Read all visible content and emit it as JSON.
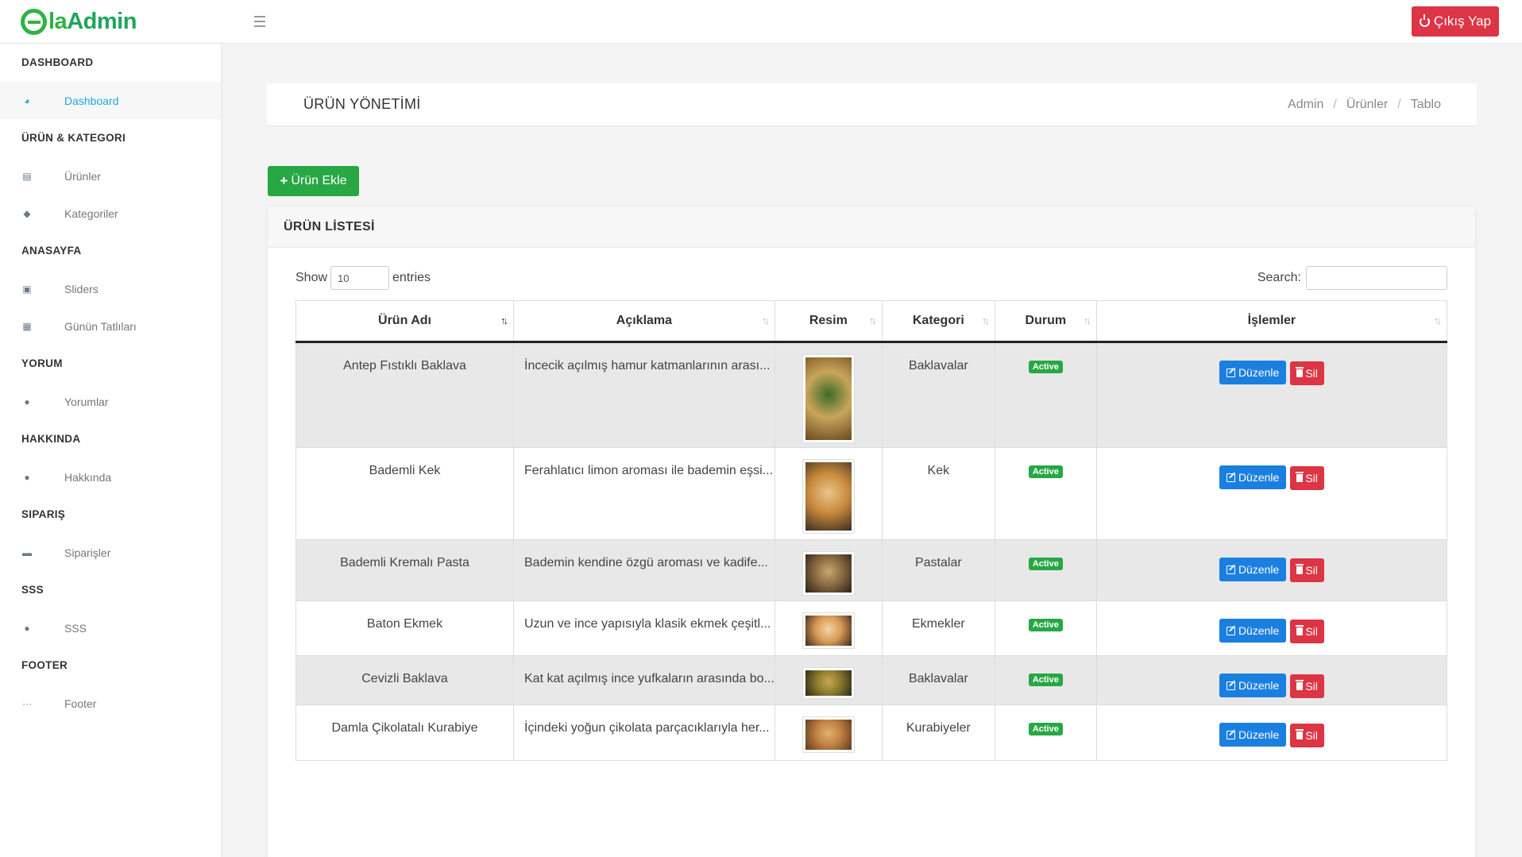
{
  "brand": {
    "logo_first": "la",
    "logo_second": "Admin"
  },
  "header": {
    "logout_label": "Çıkış Yap"
  },
  "sidebar": {
    "sections": [
      {
        "title": "DASHBOARD",
        "items": [
          {
            "label": "Dashboard",
            "icon": "dashboard-icon",
            "active": true
          }
        ]
      },
      {
        "title": "ÜRÜN & KATEGORI",
        "items": [
          {
            "label": "Ürünler",
            "icon": "basket-icon"
          },
          {
            "label": "Kategoriler",
            "icon": "tags-icon"
          }
        ]
      },
      {
        "title": "ANASAYFA",
        "items": [
          {
            "label": "Sliders",
            "icon": "image-icon"
          },
          {
            "label": "Günün Tatlıları",
            "icon": "gift-icon"
          }
        ]
      },
      {
        "title": "YORUM",
        "items": [
          {
            "label": "Yorumlar",
            "icon": "comments-icon"
          }
        ]
      },
      {
        "title": "HAKKINDA",
        "items": [
          {
            "label": "Hakkında",
            "icon": "info-icon"
          }
        ]
      },
      {
        "title": "SIPARIŞ",
        "items": [
          {
            "label": "Siparişler",
            "icon": "cart-icon"
          }
        ]
      },
      {
        "title": "SSS",
        "items": [
          {
            "label": "SSS",
            "icon": "question-icon"
          }
        ]
      },
      {
        "title": "FOOTER",
        "items": [
          {
            "label": "Footer",
            "icon": "ellipsis-icon"
          }
        ]
      }
    ]
  },
  "page": {
    "title": "ÜRÜN YÖNETİMİ",
    "breadcrumb": [
      "Admin",
      "Ürünler",
      "Tablo"
    ],
    "add_button": "Ürün Ekle"
  },
  "card": {
    "title": "ÜRÜN LİSTESİ",
    "show_label": "Show",
    "entries_value": "10",
    "entries_label": "entries",
    "search_label": "Search:"
  },
  "table": {
    "headers": [
      "Ürün Adı",
      "Açıklama",
      "Resim",
      "Kategori",
      "Durum",
      "İşlemler"
    ],
    "edit_label": "Düzenle",
    "delete_label": "Sil",
    "rows": [
      {
        "name": "Antep Fıstıklı Baklava",
        "desc": "İncecik açılmış hamur katmanlarının arası...",
        "category": "Baklavalar",
        "status": "Active",
        "img": "baklava-pistachio"
      },
      {
        "name": "Bademli Kek",
        "desc": "Ferahlatıcı limon aroması ile bademin eşsi...",
        "category": "Kek",
        "status": "Active",
        "img": "almond-cake"
      },
      {
        "name": "Bademli Kremalı Pasta",
        "desc": "Bademin kendine özgü aroması ve kadife...",
        "category": "Pastalar",
        "status": "Active",
        "img": "almond-cream-cake"
      },
      {
        "name": "Baton Ekmek",
        "desc": "Uzun ve ince yapısıyla klasik ekmek çeşitl...",
        "category": "Ekmekler",
        "status": "Active",
        "img": "baguette"
      },
      {
        "name": "Cevizli Baklava",
        "desc": "Kat kat açılmış ince yufkaların arasında bo...",
        "category": "Baklavalar",
        "status": "Active",
        "img": "walnut-baklava"
      },
      {
        "name": "Damla Çikolatalı Kurabiye",
        "desc": "İçindeki yoğun çikolata parçacıklarıyla her...",
        "category": "Kurabiyeler",
        "status": "Active",
        "img": "chocolate-chip-cookies"
      }
    ]
  }
}
